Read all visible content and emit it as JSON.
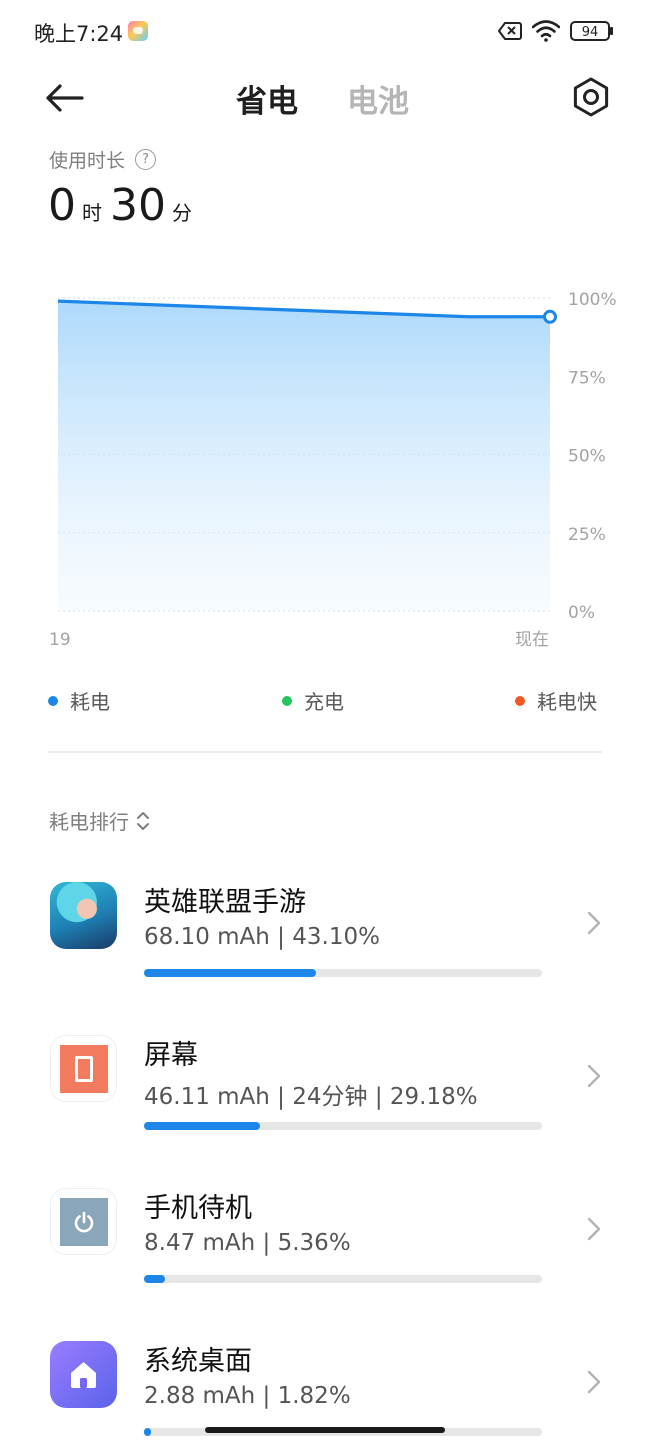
{
  "status_bar": {
    "time": "晚上7:24",
    "battery_level": "94",
    "icons": [
      "game-app-icon",
      "battery-saver-off-icon",
      "wifi-icon",
      "battery-icon"
    ]
  },
  "header": {
    "tabs": [
      {
        "label": "省电",
        "active": true
      },
      {
        "label": "电池",
        "active": false
      }
    ],
    "back_icon": "back-arrow-icon",
    "settings_icon": "settings-icon"
  },
  "usage": {
    "label": "使用时长",
    "hours": "0",
    "hours_unit": "时",
    "minutes": "30",
    "minutes_unit": "分"
  },
  "chart_data": {
    "type": "area",
    "x_labels": [
      "19",
      "现在"
    ],
    "y_ticks": [
      "100%",
      "75%",
      "50%",
      "25%",
      "0%"
    ],
    "ylim": [
      0,
      100
    ],
    "series": [
      {
        "name": "耗电",
        "color": "#1d86e9",
        "values": [
          99,
          98,
          97,
          96,
          95,
          94,
          94
        ]
      }
    ],
    "grid": true
  },
  "legend": [
    {
      "label": "耗电",
      "color": "#1d86e9"
    },
    {
      "label": "充电",
      "color": "#22c55e"
    },
    {
      "label": "耗电快",
      "color": "#f05a22"
    }
  ],
  "ranking": {
    "title": "耗电排行",
    "items": [
      {
        "name": "英雄联盟手游",
        "detail": "68.10 mAh | 43.10%",
        "percent": 43.1,
        "icon": "league-of-legends-app-icon"
      },
      {
        "name": "屏幕",
        "detail": "46.11 mAh | 24分钟 | 29.18%",
        "percent": 29.18,
        "icon": "screen-icon"
      },
      {
        "name": "手机待机",
        "detail": "8.47 mAh | 5.36%",
        "percent": 5.36,
        "icon": "standby-power-icon"
      },
      {
        "name": "系统桌面",
        "detail": "2.88 mAh | 1.82%",
        "percent": 1.82,
        "icon": "home-launcher-icon"
      }
    ]
  }
}
